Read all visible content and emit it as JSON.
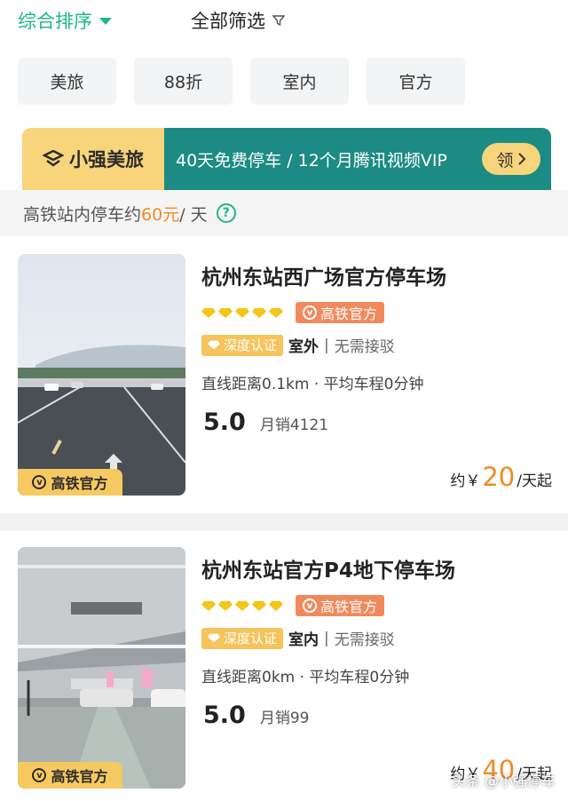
{
  "sortbar": {
    "sort_label": "综合排序",
    "filter_label": "全部筛选"
  },
  "chips": [
    "美旅",
    "88折",
    "室内",
    "官方"
  ],
  "banner": {
    "brand": "小强美旅",
    "promo": "40天免费停车 / 12个月腾讯视频VIP",
    "button": "领"
  },
  "info": {
    "prefix": "高铁站内停车约",
    "price": "60元",
    "suffix": " / 天"
  },
  "lots": [
    {
      "title": "杭州东站西广场官方停车场",
      "badge": "高铁官方",
      "official": "高铁官方",
      "cert": "深度认证",
      "location": "室外",
      "shuttle": "无需接驳",
      "distance": "直线距离0.1km · 平均车程0分钟",
      "score": "5.0",
      "sales": "月销4121",
      "price_prefix": "约￥",
      "price": "20",
      "price_suffix": "/天起",
      "rating": 5
    },
    {
      "title": "杭州东站官方P4地下停车场",
      "badge": "高铁官方",
      "official": "高铁官方",
      "cert": "深度认证",
      "location": "室内",
      "shuttle": "无需接驳",
      "distance": "直线距离0km · 平均车程0分钟",
      "score": "5.0",
      "sales": "月销99",
      "price_prefix": "约￥",
      "price": "40",
      "price_suffix": "/天起",
      "rating": 5
    }
  ],
  "watermark": "头条 @小强停车",
  "colors": {
    "accent": "#1fb888",
    "price": "#f08a24",
    "banner_gold": "#f8d47a",
    "banner_teal": "#1c8b84"
  }
}
